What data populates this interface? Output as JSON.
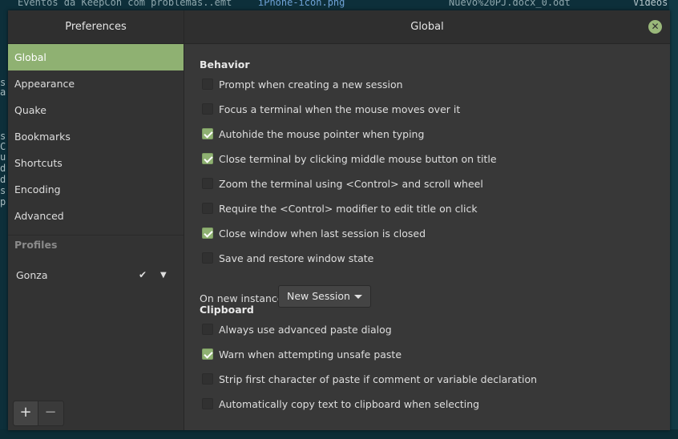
{
  "background": {
    "top_texts": [
      "Eventos da KeepCon com problemas..emt",
      "iPhone-icon.png",
      "Nuevo%20PJ.docx_0.odt",
      "Videos"
    ],
    "left_chars": [
      "s",
      "a",
      "s",
      "C",
      "u",
      "d",
      "d",
      "s",
      "p"
    ]
  },
  "window": {
    "left_title": "Preferences",
    "right_title": "Global",
    "close_label": "✕"
  },
  "sidebar": {
    "items": [
      {
        "label": "Global"
      },
      {
        "label": "Appearance"
      },
      {
        "label": "Quake"
      },
      {
        "label": "Bookmarks"
      },
      {
        "label": "Shortcuts"
      },
      {
        "label": "Encoding"
      },
      {
        "label": "Advanced"
      }
    ],
    "active_item": "Global",
    "profiles_header": "Profiles",
    "profile": {
      "name": "Gonza",
      "default_mark": "✔",
      "menu_glyph": "▼"
    },
    "add_label": "+",
    "remove_label": "−"
  },
  "behavior": {
    "header": "Behavior",
    "options": [
      {
        "label": "Prompt when creating a new session",
        "checked": false
      },
      {
        "label": "Focus a terminal when the mouse moves over it",
        "checked": false
      },
      {
        "label": "Autohide the mouse pointer when typing",
        "checked": true
      },
      {
        "label": "Close terminal by clicking middle mouse button on title",
        "checked": true
      },
      {
        "label": "Zoom the terminal using <Control> and scroll wheel",
        "checked": false
      },
      {
        "label": "Require the <Control> modifier to edit title on click",
        "checked": false
      },
      {
        "label": "Close window when last session is closed",
        "checked": true
      },
      {
        "label": "Save and restore window state",
        "checked": false
      }
    ],
    "new_instance_label": "On new instance",
    "new_instance_value": "New Session"
  },
  "clipboard": {
    "header": "Clipboard",
    "options": [
      {
        "label": "Always use advanced paste dialog",
        "checked": false
      },
      {
        "label": "Warn when attempting unsafe paste",
        "checked": true
      },
      {
        "label": "Strip first character of paste if comment or variable declaration",
        "checked": false
      },
      {
        "label": "Automatically copy text to clipboard when selecting",
        "checked": false
      }
    ]
  },
  "colors": {
    "accent": "#8fb172",
    "panel": "#383838",
    "sidebar": "#333333",
    "titlebar": "#2f2f2f"
  }
}
